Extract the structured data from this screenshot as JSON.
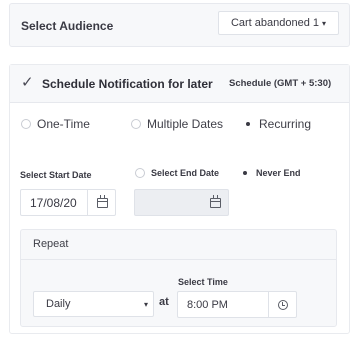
{
  "audience": {
    "label": "Select Audience",
    "selected": "Cart abandoned 1",
    "caret": "▾"
  },
  "schedule": {
    "checkbox_mark": "✓",
    "title": "Schedule Notification for later",
    "timezone": "Schedule (GMT + 5:30)",
    "frequency_options": [
      {
        "label": "One-Time",
        "selected": false
      },
      {
        "label": "Multiple Dates",
        "selected": false
      },
      {
        "label": "Recurring",
        "selected": true
      }
    ],
    "start_date": {
      "label": "Select Start Date",
      "value": "17/08/20"
    },
    "end_date": {
      "label": "Select End Date",
      "value": "",
      "selected": false
    },
    "never_end": {
      "label": "Never End",
      "selected": true
    },
    "repeat": {
      "label": "Repeat",
      "select_value": "Daily",
      "caret": "▾",
      "at_label": "at",
      "time_label": "Select Time",
      "time_value": "8:00 PM"
    }
  }
}
